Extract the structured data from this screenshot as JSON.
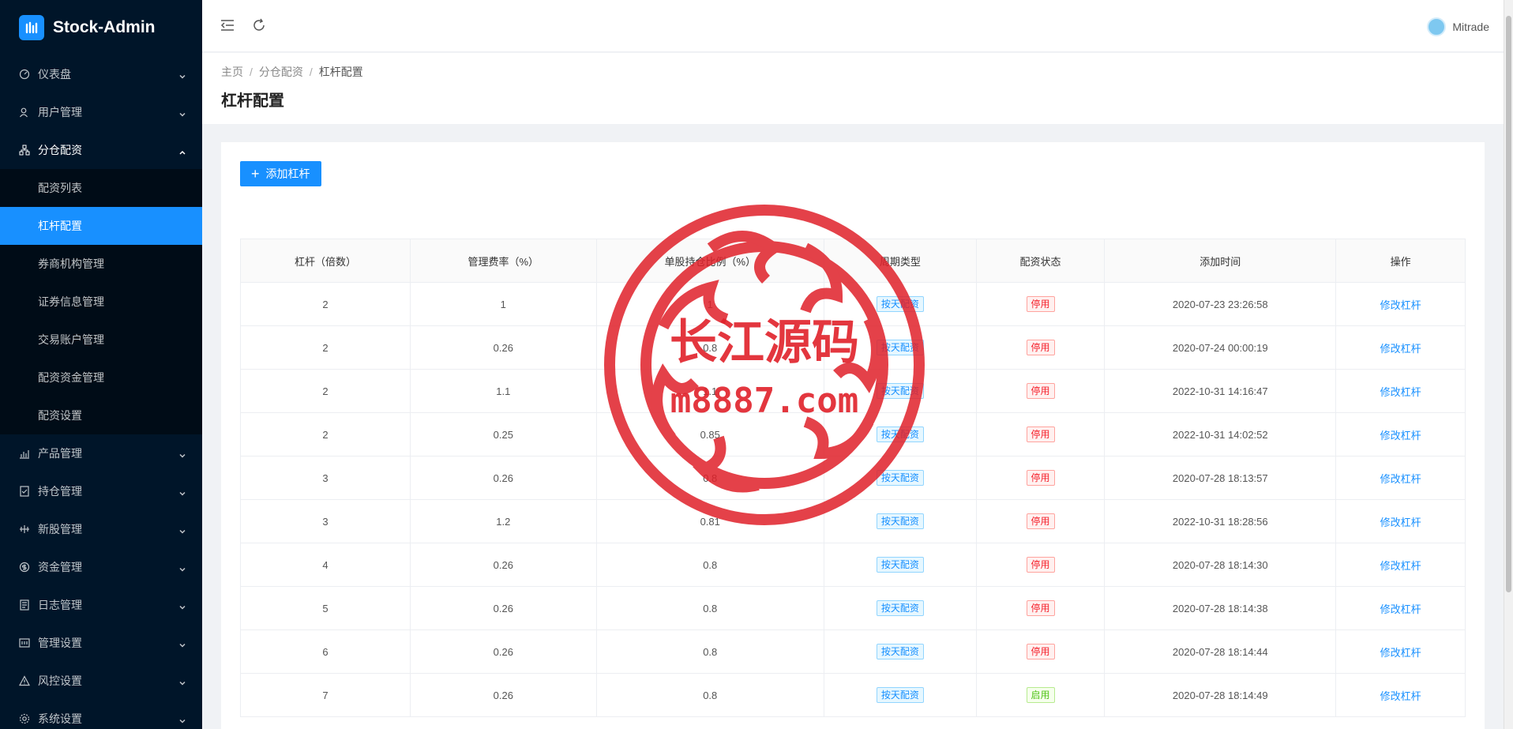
{
  "app": {
    "title": "Stock-Admin"
  },
  "sidebar": {
    "menu_before": [
      {
        "label": "仪表盘",
        "icon": "dashboard-icon"
      },
      {
        "label": "用户管理",
        "icon": "user-icon"
      }
    ],
    "open_menu": {
      "label": "分仓配资",
      "icon": "cluster-icon"
    },
    "sub_items": [
      {
        "label": "配资列表",
        "active": false
      },
      {
        "label": "杠杆配置",
        "active": true
      },
      {
        "label": "券商机构管理",
        "active": false
      },
      {
        "label": "证券信息管理",
        "active": false
      },
      {
        "label": "交易账户管理",
        "active": false
      },
      {
        "label": "配资资金管理",
        "active": false
      },
      {
        "label": "配资设置",
        "active": false
      }
    ],
    "menu_after": [
      {
        "label": "产品管理",
        "icon": "chart-icon"
      },
      {
        "label": "持仓管理",
        "icon": "position-icon"
      },
      {
        "label": "新股管理",
        "icon": "ipo-icon"
      },
      {
        "label": "资金管理",
        "icon": "money-icon"
      },
      {
        "label": "日志管理",
        "icon": "log-icon"
      },
      {
        "label": "管理设置",
        "icon": "admin-settings-icon"
      },
      {
        "label": "风控设置",
        "icon": "warning-icon"
      },
      {
        "label": "系统设置",
        "icon": "gear-icon"
      }
    ]
  },
  "header": {
    "user_name": "Mitrade"
  },
  "breadcrumb": {
    "home": "主页",
    "parent": "分仓配资",
    "current": "杠杆配置"
  },
  "page": {
    "title": "杠杆配置",
    "add_button": "添加杠杆"
  },
  "table": {
    "columns": [
      "杠杆（倍数）",
      "管理费率（%）",
      "单股持仓比例（%）",
      "周期类型",
      "配资状态",
      "添加时间",
      "操作"
    ],
    "rows": [
      {
        "leverage": "2",
        "fee": "1",
        "ratio": "1",
        "period": "按天配资",
        "status": "停用",
        "status_type": "red",
        "time": "2020-07-23 23:26:58",
        "action": "修改杠杆"
      },
      {
        "leverage": "2",
        "fee": "0.26",
        "ratio": "0.8",
        "period": "按天配资",
        "status": "停用",
        "status_type": "red",
        "time": "2020-07-24 00:00:19",
        "action": "修改杠杆"
      },
      {
        "leverage": "2",
        "fee": "1.1",
        "ratio": "1.1",
        "period": "按天配资",
        "status": "停用",
        "status_type": "red",
        "time": "2022-10-31 14:16:47",
        "action": "修改杠杆"
      },
      {
        "leverage": "2",
        "fee": "0.25",
        "ratio": "0.85",
        "period": "按天配资",
        "status": "停用",
        "status_type": "red",
        "time": "2022-10-31 14:02:52",
        "action": "修改杠杆"
      },
      {
        "leverage": "3",
        "fee": "0.26",
        "ratio": "0.8",
        "period": "按天配资",
        "status": "停用",
        "status_type": "red",
        "time": "2020-07-28 18:13:57",
        "action": "修改杠杆"
      },
      {
        "leverage": "3",
        "fee": "1.2",
        "ratio": "0.81",
        "period": "按天配资",
        "status": "停用",
        "status_type": "red",
        "time": "2022-10-31 18:28:56",
        "action": "修改杠杆"
      },
      {
        "leverage": "4",
        "fee": "0.26",
        "ratio": "0.8",
        "period": "按天配资",
        "status": "停用",
        "status_type": "red",
        "time": "2020-07-28 18:14:30",
        "action": "修改杠杆"
      },
      {
        "leverage": "5",
        "fee": "0.26",
        "ratio": "0.8",
        "period": "按天配资",
        "status": "停用",
        "status_type": "red",
        "time": "2020-07-28 18:14:38",
        "action": "修改杠杆"
      },
      {
        "leverage": "6",
        "fee": "0.26",
        "ratio": "0.8",
        "period": "按天配资",
        "status": "停用",
        "status_type": "red",
        "time": "2020-07-28 18:14:44",
        "action": "修改杠杆"
      },
      {
        "leverage": "7",
        "fee": "0.26",
        "ratio": "0.8",
        "period": "按天配资",
        "status": "启用",
        "status_type": "green",
        "time": "2020-07-28 18:14:49",
        "action": "修改杠杆"
      }
    ]
  },
  "watermark": {
    "line1": "长江源码",
    "line2": "m8887.com",
    "color": "#e0212a"
  },
  "colors": {
    "primary": "#1890ff",
    "sidebar_bg": "#001529",
    "submenu_bg": "#000c17"
  }
}
